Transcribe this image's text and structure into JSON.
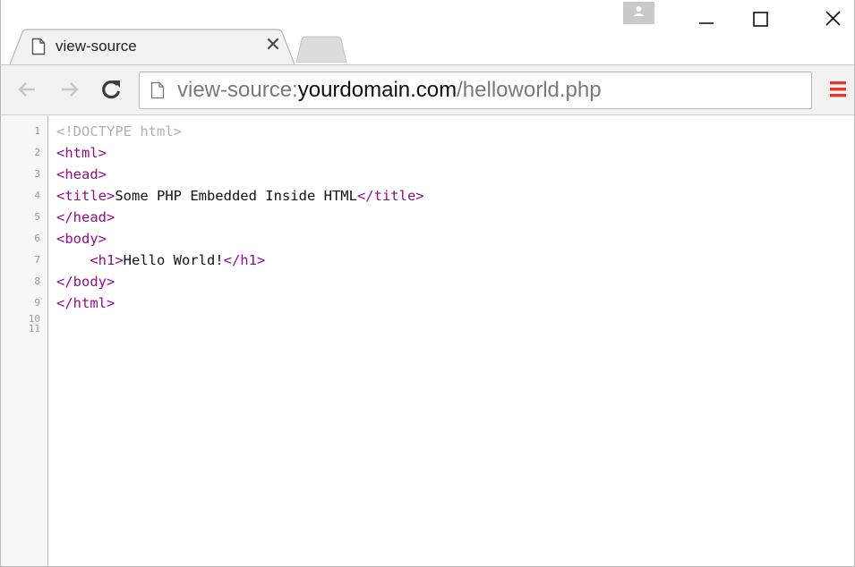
{
  "tab": {
    "title": "view-source",
    "close_glyph": "✕"
  },
  "window_controls": {
    "profile_icon": "person-icon",
    "minimize_glyph": "—",
    "maximize_glyph": "☐",
    "close_glyph": "✕"
  },
  "toolbar": {
    "back_icon": "back-arrow-icon",
    "forward_icon": "forward-arrow-icon",
    "reload_icon": "reload-icon",
    "menu_icon": "hamburger-menu-icon",
    "menu_color": "#e0382b"
  },
  "omnibox": {
    "scheme": "view-source:",
    "host": "yourdomain.com",
    "path": "/helloworld.php"
  },
  "source": {
    "line_numbers": [
      "1",
      "2",
      "3",
      "4",
      "5",
      "6",
      "7",
      "8",
      "9",
      "10",
      "11"
    ],
    "lines": [
      {
        "parts": [
          {
            "type": "doctype",
            "text": "<!DOCTYPE html>"
          }
        ]
      },
      {
        "parts": [
          {
            "type": "tag",
            "text": "<html>"
          }
        ]
      },
      {
        "parts": [
          {
            "type": "tag",
            "text": "<head>"
          }
        ]
      },
      {
        "parts": [
          {
            "type": "tag",
            "text": "<title>"
          },
          {
            "type": "text",
            "text": "Some PHP Embedded Inside HTML"
          },
          {
            "type": "tag",
            "text": "</title>"
          }
        ]
      },
      {
        "parts": [
          {
            "type": "tag",
            "text": "</head>"
          }
        ]
      },
      {
        "parts": [
          {
            "type": "tag",
            "text": "<body>"
          }
        ]
      },
      {
        "parts": [
          {
            "type": "text",
            "text": "    "
          },
          {
            "type": "tag",
            "text": "<h1>"
          },
          {
            "type": "text",
            "text": "Hello World!"
          },
          {
            "type": "tag",
            "text": "</h1>"
          }
        ]
      },
      {
        "parts": [
          {
            "type": "tag",
            "text": "</body>"
          }
        ]
      },
      {
        "parts": [
          {
            "type": "tag",
            "text": "</html>"
          }
        ]
      }
    ]
  },
  "colors": {
    "tag": "#881280",
    "doctype": "#b0b0b0",
    "text": "#111111"
  }
}
